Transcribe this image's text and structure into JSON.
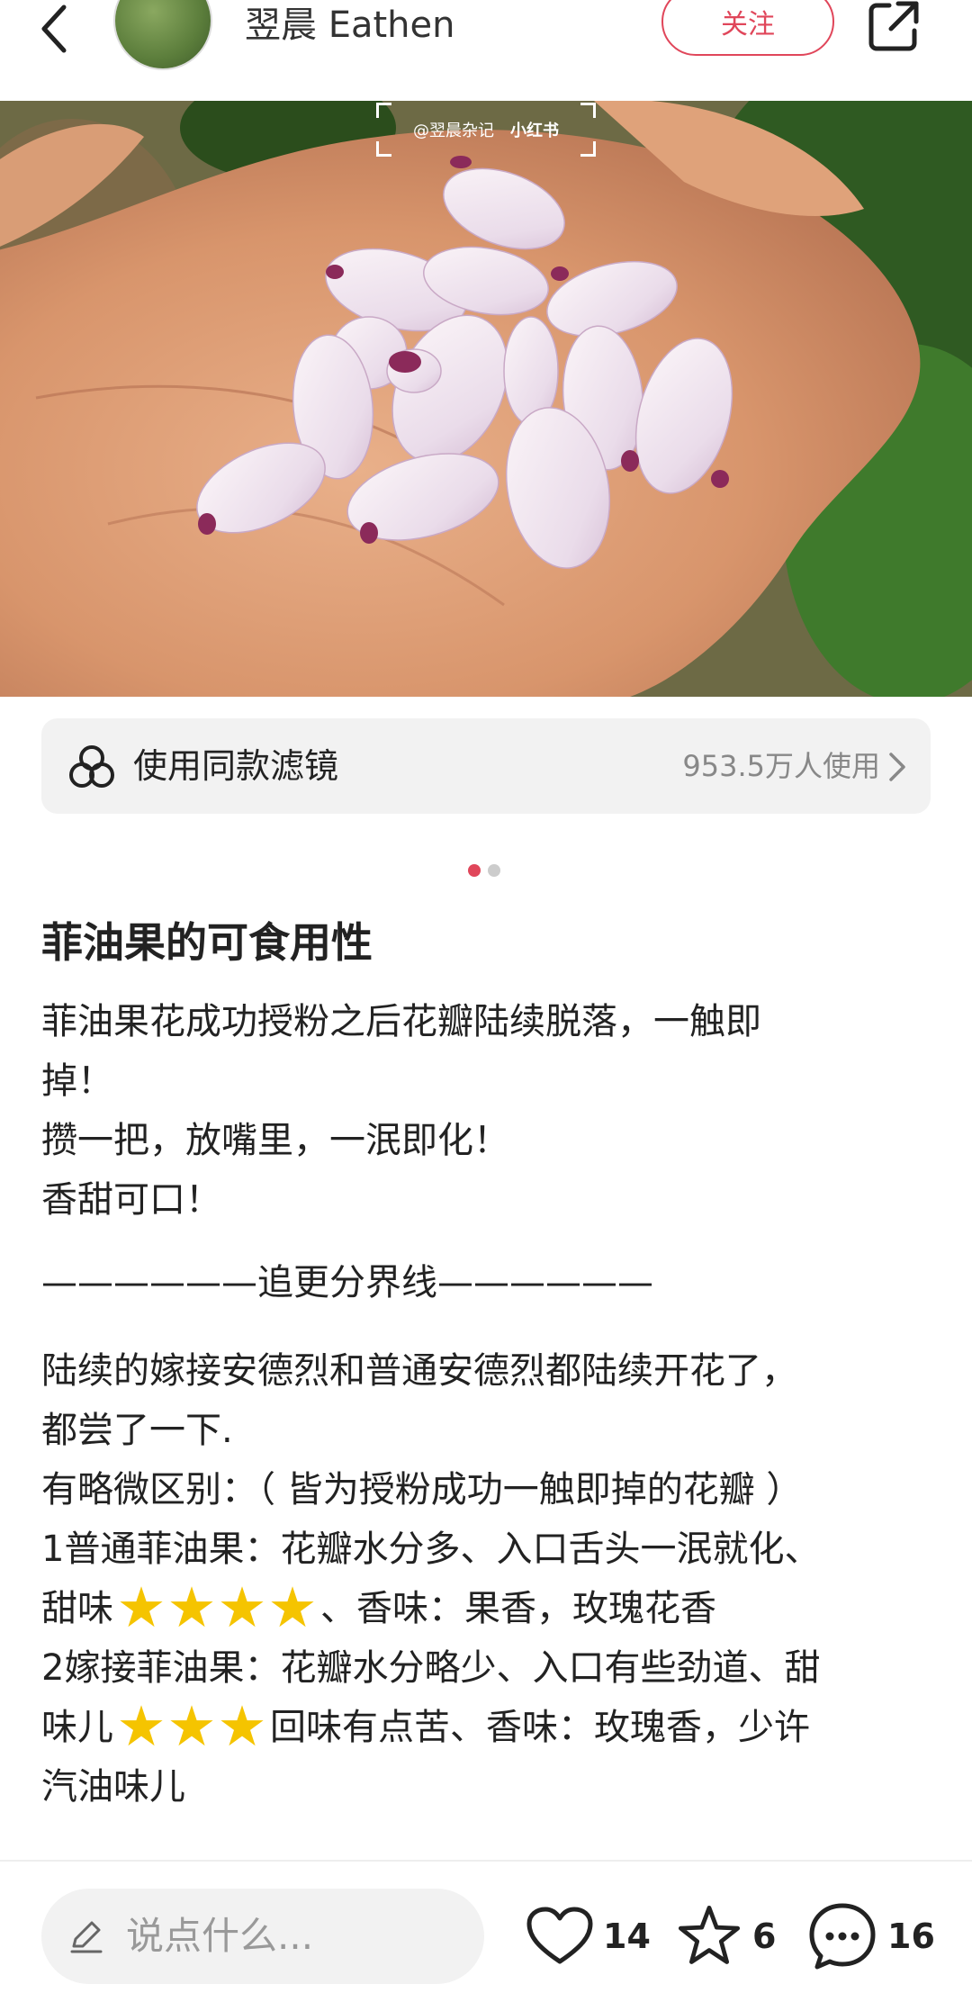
{
  "header": {
    "username": "翌晨 Eathen",
    "follow_label": "关注"
  },
  "photo": {
    "watermark_handle": "@翌晨杂记",
    "watermark_brand": "小红书"
  },
  "filter": {
    "label": "使用同款滤镜",
    "count": "953.5万人使用"
  },
  "carousel": {
    "current": 1,
    "total": 2
  },
  "post": {
    "title": "菲油果的可食用性",
    "lines": [
      "菲油果花成功授粉之后花瓣陆续脱落，一触即",
      "掉！",
      "攒一把，放嘴里，一泯即化！",
      "香甜可口！",
      "——————追更分界线——————",
      "陆续的嫁接安德烈和普通安德烈都陆续开花了，",
      "都尝了一下.",
      "有略微区别：（ 皆为授粉成功一触即掉的花瓣 ）",
      "1普通菲油果：花瓣水分多、入口舌头一泯就化、",
      "2嫁接菲油果：花瓣水分略少、入口有些劲道、甜",
      "汽油味儿"
    ],
    "line_sweet1_prefix": "甜味",
    "line_sweet1_suffix": "、香味：果香，玫瑰花香",
    "line_sweet2_prefix": "味儿",
    "line_sweet2_suffix": "回味有点苦、香味：玫瑰香，少许"
  },
  "bottom": {
    "comment_placeholder": "说点什么...",
    "likes": "14",
    "collects": "6",
    "comments": "16"
  },
  "colors": {
    "accent": "#e0465a",
    "star": "#f5c400"
  }
}
